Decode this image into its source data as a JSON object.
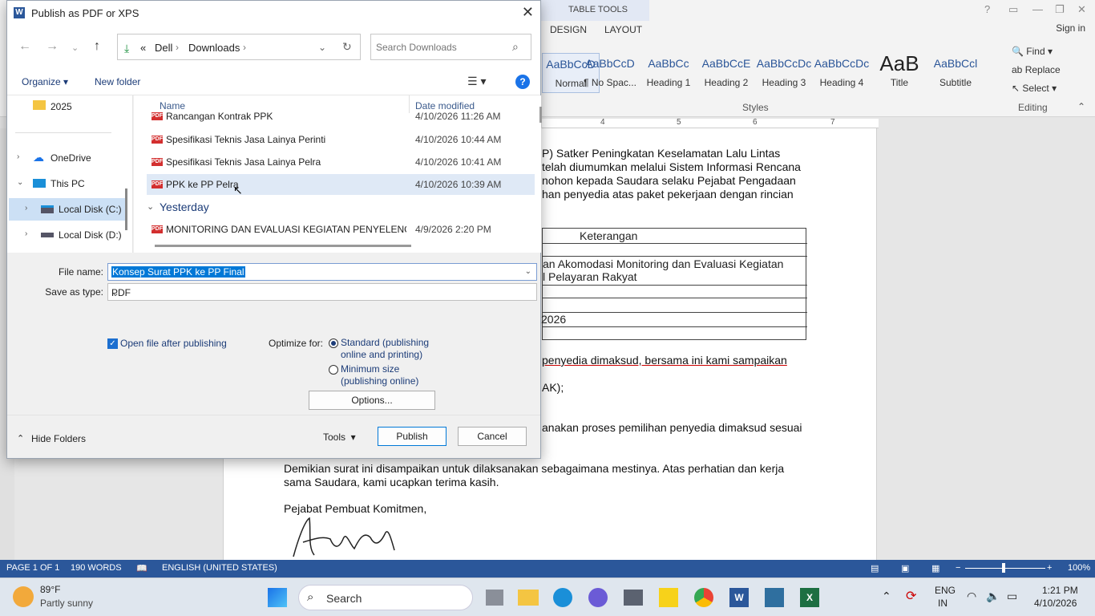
{
  "word": {
    "tabs": {
      "table_tools": "TABLE TOOLS",
      "design": "DESIGN",
      "layout": "LAYOUT"
    },
    "sign_in": "Sign in",
    "styles": [
      {
        "preview": "AaBbCcD",
        "name": "Normal"
      },
      {
        "preview": "AaBbCcD",
        "name": "¶ No Spac..."
      },
      {
        "preview": "AaBbCc",
        "name": "Heading 1"
      },
      {
        "preview": "AaBbCcE",
        "name": "Heading 2"
      },
      {
        "preview": "AaBbCcDc",
        "name": "Heading 3"
      },
      {
        "preview": "AaBbCcDc",
        "name": "Heading 4"
      },
      {
        "preview": "AaB",
        "name": "Title"
      },
      {
        "preview": "AaBbCcl",
        "name": "Subtitle"
      }
    ],
    "styles_group": "Styles",
    "editing": {
      "find": "Find",
      "replace": "Replace",
      "select": "Select",
      "group": "Editing"
    },
    "ruler": [
      "4",
      "5",
      "6",
      "7"
    ],
    "doc": {
      "p1": [
        "P) Satker Peningkatan Keselamatan Lalu Lintas",
        "telah diumumkan melalui Sistem Informasi Rencana",
        "nohon kepada Saudara selaku Pejabat Pengadaan",
        "han penyedia atas paket pekerjaan dengan rincian"
      ],
      "table_header": "Keterangan",
      "table_row1": "an Akomodasi Monitoring dan Evaluasi Kegiatan",
      "table_row1b": "l Pelayaran Rakyat",
      "table_row2": "2026",
      "p2": "penyedia dimaksud, bersama ini kami sampaikan",
      "p2b": "AK);",
      "p3": "anakan proses pemilihan penyedia dimaksud sesuai",
      "p4a": "Demikian surat ini disampaikan untuk dilaksanakan sebagaimana mestinya. Atas perhatian dan kerja",
      "p4b": "sama Saudara, kami ucapkan terima kasih.",
      "signer": "Pejabat Pembuat Komitmen,"
    },
    "status": {
      "page": "PAGE 1 OF 1",
      "words": "190 WORDS",
      "lang": "ENGLISH (UNITED STATES)",
      "zoom": "100%"
    }
  },
  "taskbar": {
    "weather_temp": "89°F",
    "weather_desc": "Partly sunny",
    "search": "Search",
    "lang": "ENG",
    "lang2": "IN",
    "time": "1:21 PM",
    "date": "4/10/2026"
  },
  "dialog": {
    "title": "Publish as PDF or XPS",
    "breadcrumb": [
      "«",
      "Dell",
      "Downloads"
    ],
    "search_placeholder": "Search Downloads",
    "organize": "Organize",
    "new_folder": "New folder",
    "nav": [
      {
        "label": "2025"
      },
      {
        "label": "OneDrive"
      },
      {
        "label": "This PC"
      },
      {
        "label": "Local Disk (C:)"
      },
      {
        "label": "Local Disk (D:)"
      }
    ],
    "columns": {
      "name": "Name",
      "date": "Date modified"
    },
    "files": [
      {
        "name": "Rancangan Kontrak PPK",
        "date": "4/10/2026 11:26 AM"
      },
      {
        "name": "Spesifikasi Teknis Jasa Lainya Perinti",
        "date": "4/10/2026 10:44 AM"
      },
      {
        "name": "Spesifikasi Teknis Jasa Lainya Pelra",
        "date": "4/10/2026 10:41 AM"
      },
      {
        "name": "PPK ke PP Pelra",
        "date": "4/10/2026 10:39 AM"
      }
    ],
    "group_yesterday": "Yesterday",
    "files_yesterday": [
      {
        "name": "MONITORING DAN EVALUASI KEGIATAN PENYELENGG...",
        "date": "4/9/2026 2:20 PM"
      }
    ],
    "file_name_label": "File name:",
    "file_name_value": "Konsep Surat PPK ke PP Final",
    "save_type_label": "Save as type:",
    "save_type_value": "PDF",
    "open_after": "Open file after publishing",
    "optimize_label": "Optimize for:",
    "opt_standard": [
      "Standard (publishing",
      "online and printing)"
    ],
    "opt_minimum": [
      "Minimum size",
      "(publishing online)"
    ],
    "options_btn": "Options...",
    "hide_folders": "Hide Folders",
    "tools": "Tools",
    "publish": "Publish",
    "cancel": "Cancel"
  }
}
